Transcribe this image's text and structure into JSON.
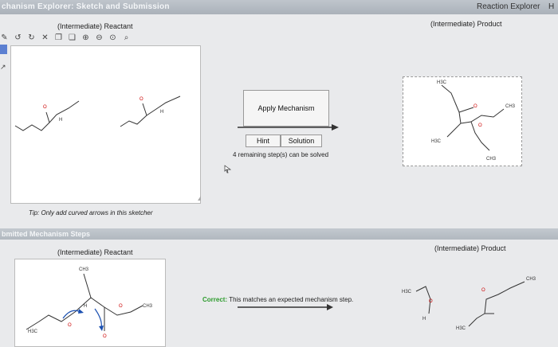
{
  "window": {
    "title": "chanism Explorer: Sketch and Submission",
    "reaction_explorer": "Reaction Explorer",
    "help": "H"
  },
  "reactant_panel": {
    "title": "(Intermediate) Reactant",
    "tip": "Tip: Only add curved arrows in this sketcher"
  },
  "product_panel": {
    "title": "(Intermediate) Product"
  },
  "controls": {
    "apply": "Apply Mechanism",
    "hint": "Hint",
    "solution": "Solution",
    "steps": "4 remaining step(s) can be solved"
  },
  "submitted": {
    "header": "bmitted Mechanism Steps",
    "reactant_title": "(Intermediate) Reactant",
    "product_title": "(Intermediate) Product",
    "correct_label": "Correct:",
    "correct_text": "This matches an expected mechanism step."
  },
  "molecule_labels": {
    "ch3": "CH3",
    "h3c": "H3C",
    "o": "O",
    "h": "H",
    "ch3_sub": "3"
  },
  "colors": {
    "accent": "#2c9b2c",
    "bond": "#333333",
    "charge": "#cc0000",
    "arrow": "#1a4fb0"
  },
  "icons": [
    "undo-icon",
    "redo-icon",
    "delete-icon",
    "copy-icon",
    "paste-icon",
    "zoom-in-icon",
    "zoom-out-icon",
    "zoom-fit-icon",
    "pen-icon"
  ]
}
